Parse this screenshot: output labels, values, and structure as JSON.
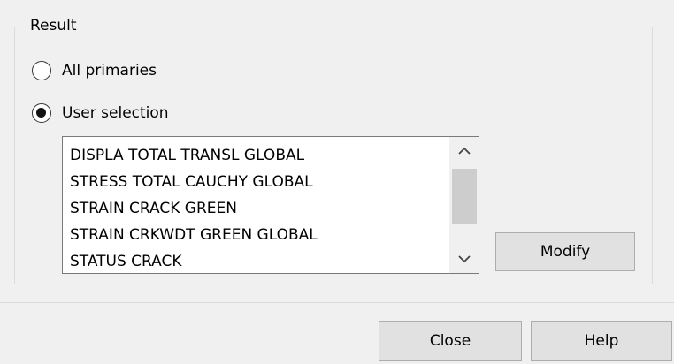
{
  "group": {
    "title": "Result"
  },
  "radios": [
    {
      "label": "All primaries",
      "checked": false
    },
    {
      "label": "User selection",
      "checked": true
    }
  ],
  "list": {
    "items": [
      "DISPLA TOTAL TRANSL GLOBAL",
      "STRESS TOTAL CAUCHY GLOBAL",
      "STRAIN CRACK GREEN",
      "STRAIN CRKWDT GREEN GLOBAL",
      "STATUS CRACK"
    ]
  },
  "buttons": {
    "modify": "Modify",
    "close": "Close",
    "help": "Help"
  }
}
